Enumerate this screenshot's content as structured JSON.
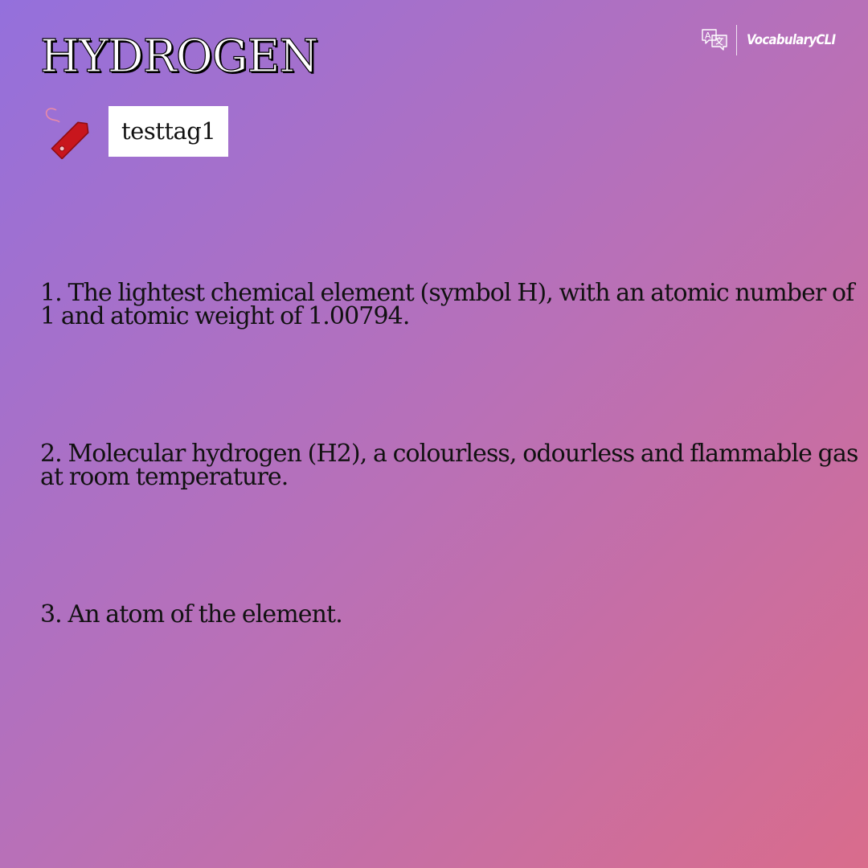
{
  "word": "HYDROGEN",
  "brand": {
    "name": "VocabularyCLI",
    "icon": "translate-icon"
  },
  "tag": {
    "icon": "tag-icon",
    "label": "testtag1",
    "icon_color": "#c8161d"
  },
  "definitions": [
    "1. The lightest chemical element (symbol H), with an atomic number of 1 and atomic weight of 1.00794.",
    "2. Molecular hydrogen (H2), a colourless, odourless and flammable gas at room temperature.",
    "3. An atom of the element."
  ],
  "colors": {
    "gradient_start": "#9470dc",
    "gradient_end": "#d96c8c",
    "text": "#111111",
    "title_fill": "#ffffff"
  }
}
